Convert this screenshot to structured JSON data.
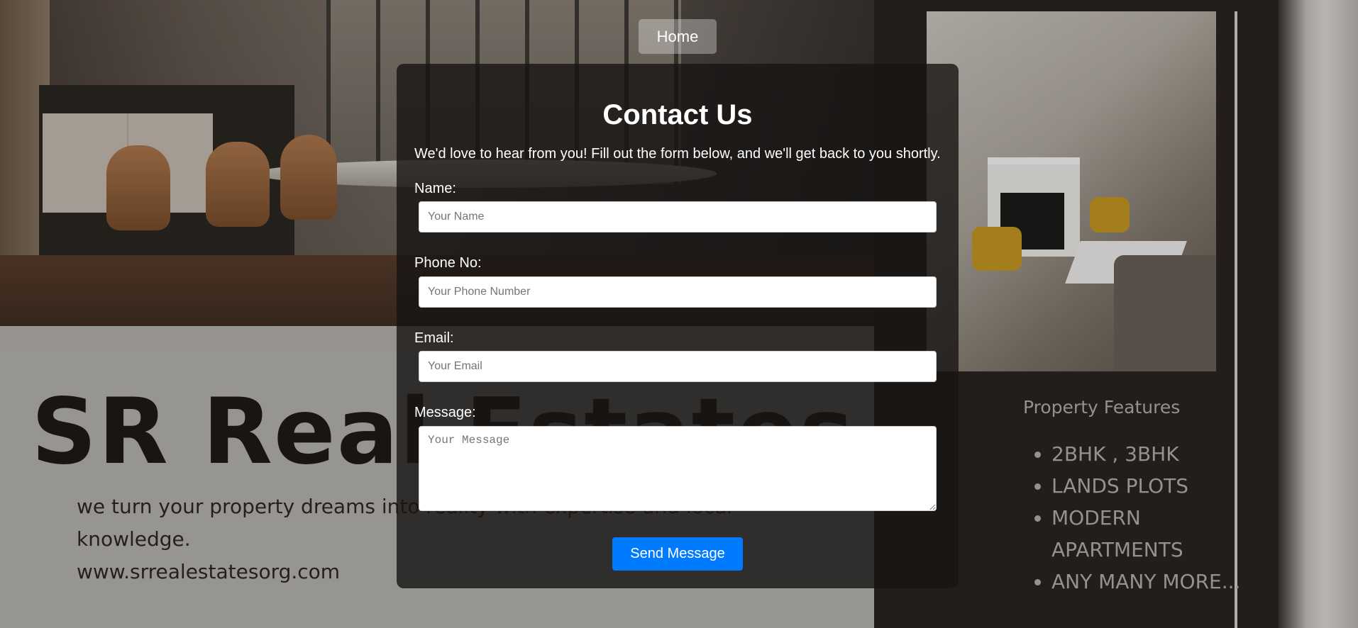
{
  "nav": {
    "home_label": "Home"
  },
  "background_flyer": {
    "brand": "SR Real Estates",
    "tagline": "we turn your property dreams into reality with expertise and local knowledge.",
    "website": "www.srrealestatesorg.com",
    "features_title": "Property Features",
    "features": [
      "2BHK , 3BHK",
      "LANDS PLOTS",
      "MODERN APARTMENTS",
      "ANY MANY MORE..."
    ]
  },
  "contact": {
    "title": "Contact Us",
    "intro": "We'd love to hear from you! Fill out the form below, and we'll get back to you shortly.",
    "fields": {
      "name": {
        "label": "Name:",
        "placeholder": "Your Name",
        "value": ""
      },
      "phone": {
        "label": "Phone No:",
        "placeholder": "Your Phone Number",
        "value": ""
      },
      "email": {
        "label": "Email:",
        "placeholder": "Your Email",
        "value": ""
      },
      "message": {
        "label": "Message:",
        "placeholder": "Your Message",
        "value": ""
      }
    },
    "submit_label": "Send Message"
  },
  "colors": {
    "accent": "#007bff",
    "card_background": "#161413",
    "text_on_card": "#ffffff"
  }
}
